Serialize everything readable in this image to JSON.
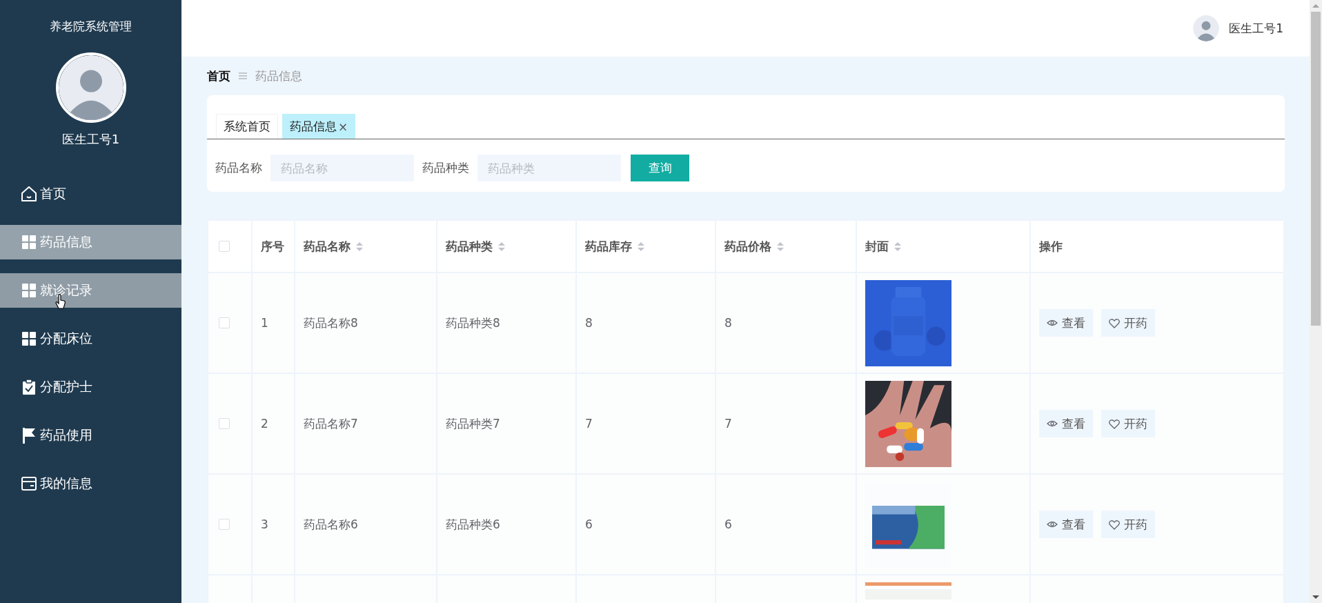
{
  "sidebar": {
    "title": "养老院系统管理",
    "user_name": "医生工号1",
    "items": [
      {
        "label": "首页",
        "kind": "home",
        "selected": false,
        "hovered": false
      },
      {
        "label": "药品信息",
        "kind": "grid",
        "selected": true,
        "hovered": false
      },
      {
        "label": "就诊记录",
        "kind": "grid",
        "selected": false,
        "hovered": true
      },
      {
        "label": "分配床位",
        "kind": "grid",
        "selected": false,
        "hovered": false
      },
      {
        "label": "分配护士",
        "kind": "clipboard",
        "selected": false,
        "hovered": false
      },
      {
        "label": "药品使用",
        "kind": "flag",
        "selected": false,
        "hovered": false
      },
      {
        "label": "我的信息",
        "kind": "card",
        "selected": false,
        "hovered": false
      }
    ]
  },
  "header": {
    "user_name": "医生工号1"
  },
  "breadcrumb": [
    {
      "label": "首页",
      "current": false
    },
    {
      "label": "药品信息",
      "current": true
    }
  ],
  "tabs": [
    {
      "label": "系统首页",
      "selected": false
    },
    {
      "label": "药品信息",
      "selected": true,
      "close": "×"
    }
  ],
  "search": {
    "fields": [
      {
        "label": "药品名称",
        "placeholder": "药品名称"
      },
      {
        "label": "药品种类",
        "placeholder": "药品种类"
      }
    ],
    "button": "查询"
  },
  "table": {
    "all_checked": false,
    "columns": [
      {
        "label": "序号",
        "sortable": false
      },
      {
        "label": "药品名称",
        "sortable": true
      },
      {
        "label": "药品种类",
        "sortable": true
      },
      {
        "label": "药品库存",
        "sortable": true
      },
      {
        "label": "药品价格",
        "sortable": true
      },
      {
        "label": "封面",
        "sortable": true
      },
      {
        "label": "操作",
        "sortable": false
      }
    ],
    "rows": [
      {
        "checked": false,
        "cells": [
          "1",
          "药品名称8",
          "药品种类8",
          "8",
          "8"
        ],
        "cover": {
          "kind": "picture"
        },
        "actions": [
          {
            "label": "查看",
            "kind": "view"
          },
          {
            "label": "开药",
            "kind": "prescribe"
          }
        ]
      },
      {
        "checked": false,
        "cells": [
          "2",
          "药品名称7",
          "药品种类7",
          "7",
          "7"
        ],
        "cover": {
          "kind": "picture"
        },
        "actions": [
          {
            "label": "查看",
            "kind": "view"
          },
          {
            "label": "开药",
            "kind": "prescribe"
          }
        ]
      },
      {
        "checked": false,
        "cells": [
          "3",
          "药品名称6",
          "药品种类6",
          "6",
          "6"
        ],
        "cover": {
          "kind": "picture"
        },
        "actions": [
          {
            "label": "查看",
            "kind": "view"
          },
          {
            "label": "开药",
            "kind": "prescribe"
          }
        ]
      },
      {
        "cover": {
          "kind": "picture"
        }
      }
    ]
  }
}
